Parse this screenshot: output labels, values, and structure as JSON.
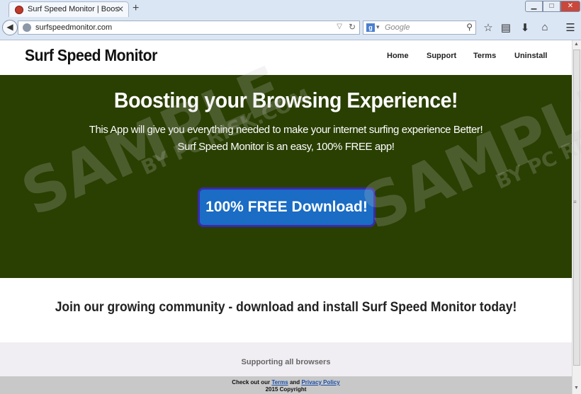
{
  "browser": {
    "tab_title": "Surf Speed Monitor | Boost...",
    "tab_close": "✕",
    "new_tab": "+",
    "url": "surfspeedmonitor.com",
    "search_placeholder": "Google",
    "window_min": "▁",
    "window_max": "□",
    "window_close": "✕"
  },
  "site": {
    "logo": "Surf Speed Monitor",
    "nav": [
      "Home",
      "Support",
      "Terms",
      "Uninstall"
    ]
  },
  "hero": {
    "title": "Boosting your Browsing Experience!",
    "subtitle_line1": "This App will give you everything needed to make your internet surfing experience Better!",
    "subtitle_line2": "Surf Speed Monitor is an easy, 100% FREE app!",
    "download_label": "100% FREE Download!"
  },
  "community": {
    "text": "Join our growing community - download and install Surf Speed Monitor today!"
  },
  "supporting": {
    "text": "Supporting all browsers"
  },
  "footer": {
    "prefix": "Check out our",
    "terms_link": "Terms",
    "and": "and",
    "privacy_link": "Privacy Policy",
    "copyright": "2015 Copyright"
  },
  "watermark": {
    "text": "SAMPLE",
    "sub": "BY PC RISK.COM"
  },
  "colors": {
    "hero_bg": "#2a3f02",
    "button_bg": "#1a6cc4",
    "button_border": "#3b2aa8"
  }
}
